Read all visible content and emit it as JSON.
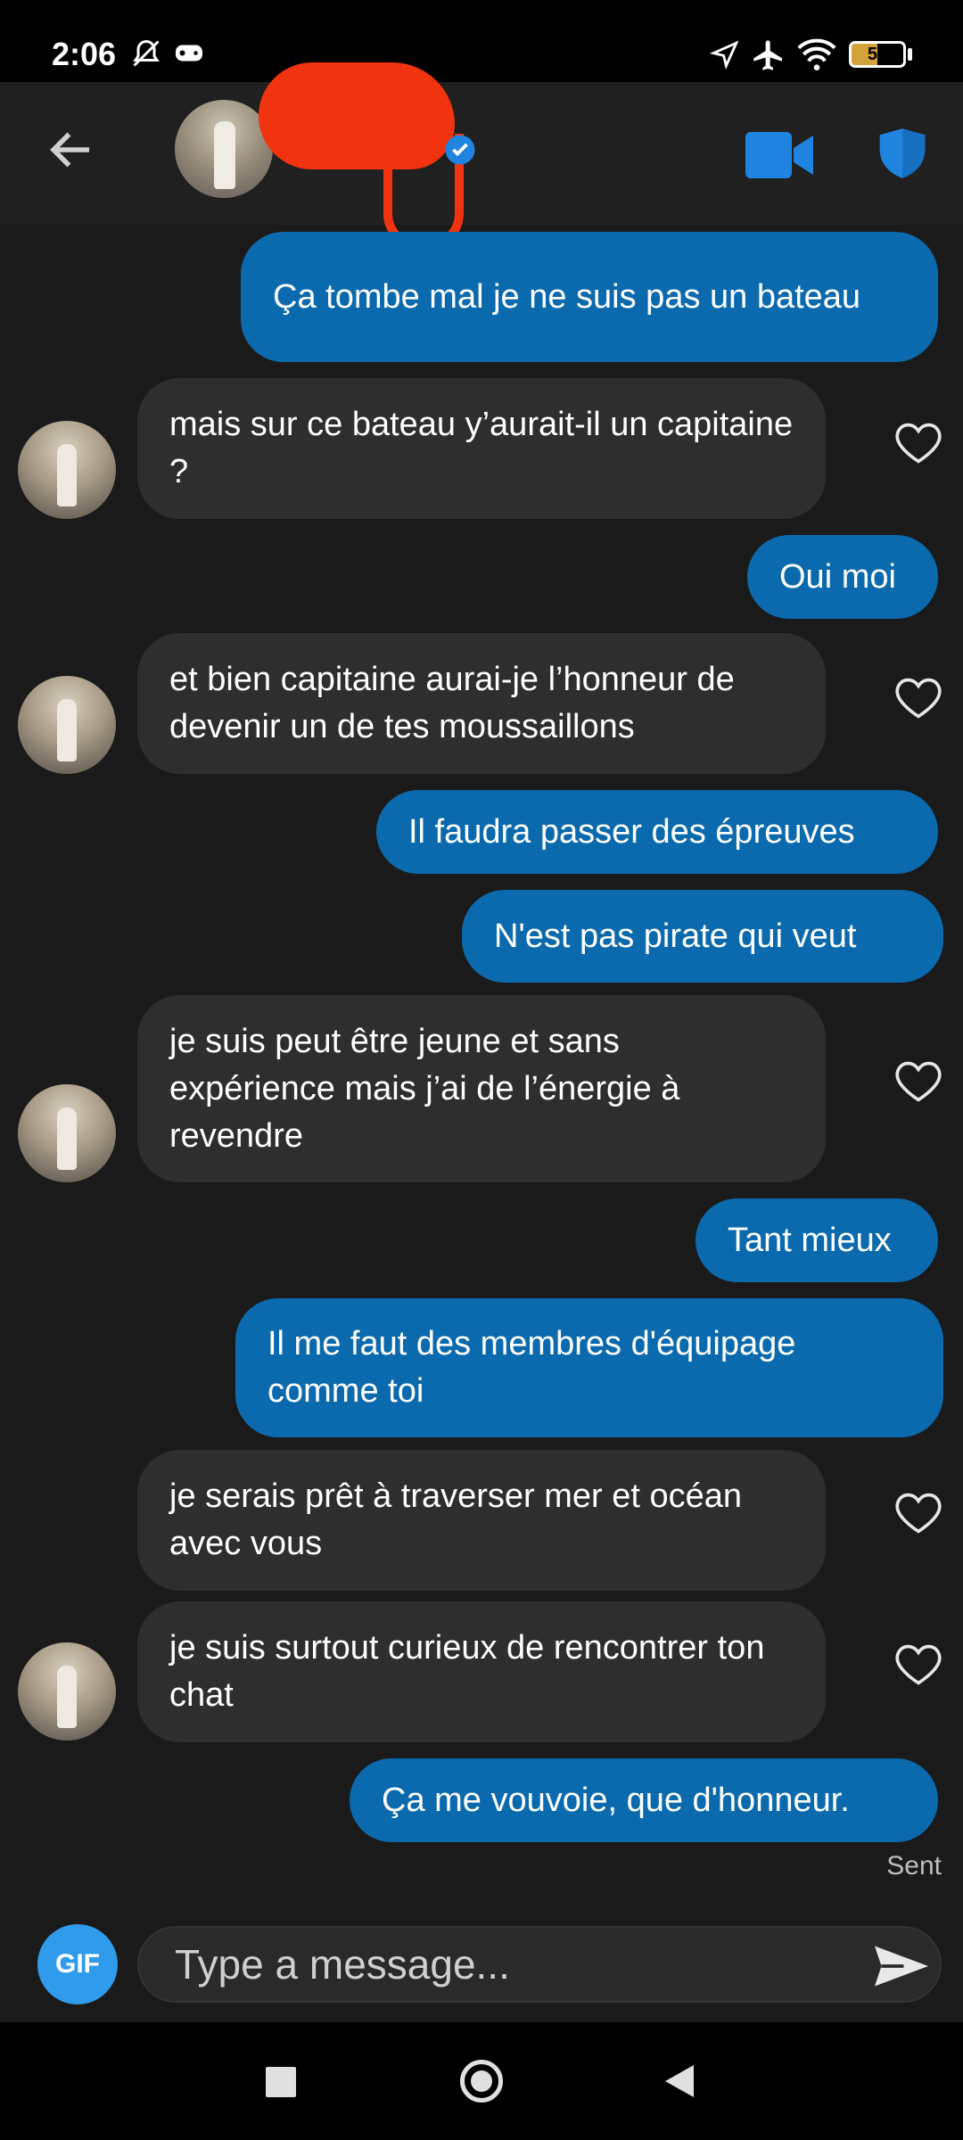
{
  "status_bar": {
    "time": "2:06",
    "battery": "50"
  },
  "header": {
    "back_icon": "arrow-left-icon",
    "video_icon": "video-camera-icon",
    "shield_icon": "shield-icon"
  },
  "messages": [
    {
      "side": "sent",
      "text": "Ça tombe mal je ne suis pas un bateau"
    },
    {
      "side": "received",
      "text": "mais sur ce bateau y’aurait-il un capitaine ?"
    },
    {
      "side": "sent",
      "text": "Oui moi"
    },
    {
      "side": "received",
      "text": "et bien capitaine aurai-je l’honneur de devenir un de tes moussaillons"
    },
    {
      "side": "sent",
      "text": "Il faudra passer des épreuves"
    },
    {
      "side": "sent",
      "text": "N'est pas pirate qui veut"
    },
    {
      "side": "received",
      "text": "je suis peut être jeune et sans expérience mais j’ai de l’énergie à revendre"
    },
    {
      "side": "sent",
      "text": "Tant mieux"
    },
    {
      "side": "sent",
      "text": "Il me faut des membres d'équipage comme toi"
    },
    {
      "side": "received",
      "text": "je serais prêt à traverser mer et océan avec vous"
    },
    {
      "side": "received",
      "text": "je suis surtout curieux de rencontrer ton chat"
    },
    {
      "side": "sent",
      "text": "Ça me vouvoie, que d'honneur."
    }
  ],
  "sent_status": "Sent",
  "composer": {
    "gif_label": "GIF",
    "placeholder": "Type a message..."
  },
  "colors": {
    "sent_bubble": "#0a6aad",
    "received_bubble": "#2e2e2e",
    "accent": "#2f9bea",
    "redaction": "#f2330f"
  }
}
